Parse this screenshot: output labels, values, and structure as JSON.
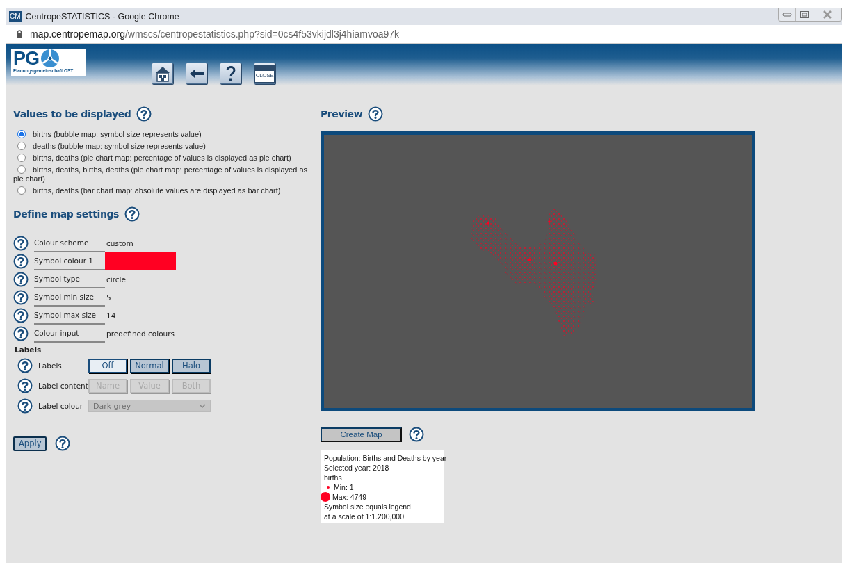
{
  "window": {
    "icon_text": "CM",
    "title": "CentropeSTATISTICS - Google Chrome",
    "url_host": "map.centropemap.org",
    "url_path": "/wmscs/centropestatistics.php?sid=0cs4f53vkijdl3j4hiamvoa97k"
  },
  "header": {
    "logo_text": "PG",
    "logo_subtitle": "Planungsgemeinschaft OST",
    "tools": [
      {
        "kind": "home"
      },
      {
        "kind": "back"
      },
      {
        "kind": "help"
      },
      {
        "kind": "close",
        "label": "CLOSE"
      }
    ]
  },
  "values": {
    "title": "Values to be displayed",
    "options": [
      {
        "label": "births (bubble map: symbol size represents value)",
        "selected": true
      },
      {
        "label": "deaths (bubble map: symbol size represents value)",
        "selected": false
      },
      {
        "label": "births, deaths (pie chart map: percentage of values is displayed as pie chart)",
        "selected": false
      },
      {
        "label": "births, deaths, births, deaths (pie chart map: percentage of values is displayed as pie chart)",
        "selected": false
      },
      {
        "label": "births, deaths (bar chart map: absolute values are displayed as bar chart)",
        "selected": false
      }
    ]
  },
  "map_settings": {
    "title": "Define map settings",
    "rows": [
      {
        "label": "Colour scheme",
        "kind": "text",
        "value": "custom"
      },
      {
        "label": "Symbol colour 1",
        "kind": "color",
        "color": "#ff0022"
      },
      {
        "label": "Symbol type",
        "kind": "text",
        "value": "circle"
      },
      {
        "label": "Symbol min size",
        "kind": "text",
        "value": "5"
      },
      {
        "label": "Symbol max size",
        "kind": "text",
        "value": "14"
      },
      {
        "label": "Colour input",
        "kind": "text",
        "value": "predefined colours"
      }
    ]
  },
  "labels": {
    "title": "Labels",
    "rows": [
      {
        "label": "Labels",
        "kind": "toggle",
        "options": [
          {
            "label": "Off",
            "selected": true,
            "disabled": false
          },
          {
            "label": "Normal",
            "selected": false,
            "disabled": false
          },
          {
            "label": "Halo",
            "selected": false,
            "disabled": false
          }
        ]
      },
      {
        "label": "Label content",
        "kind": "toggle",
        "options": [
          {
            "label": "Name",
            "selected": false,
            "disabled": true
          },
          {
            "label": "Value",
            "selected": false,
            "disabled": true
          },
          {
            "label": "Both",
            "selected": false,
            "disabled": true
          }
        ]
      },
      {
        "label": "Label colour",
        "kind": "select",
        "value": "Dark grey",
        "disabled": true
      }
    ]
  },
  "apply": {
    "label": "Apply"
  },
  "preview": {
    "title": "Preview",
    "create_button": "Create Map",
    "legend": {
      "title": "Population: Births and Deaths by year",
      "year": "Selected year: 2018",
      "variable": "births",
      "min": "Min: 1",
      "max": "Max: 4749",
      "note": [
        "Symbol size equals legend",
        "at a scale of 1:1.200,000"
      ]
    }
  }
}
